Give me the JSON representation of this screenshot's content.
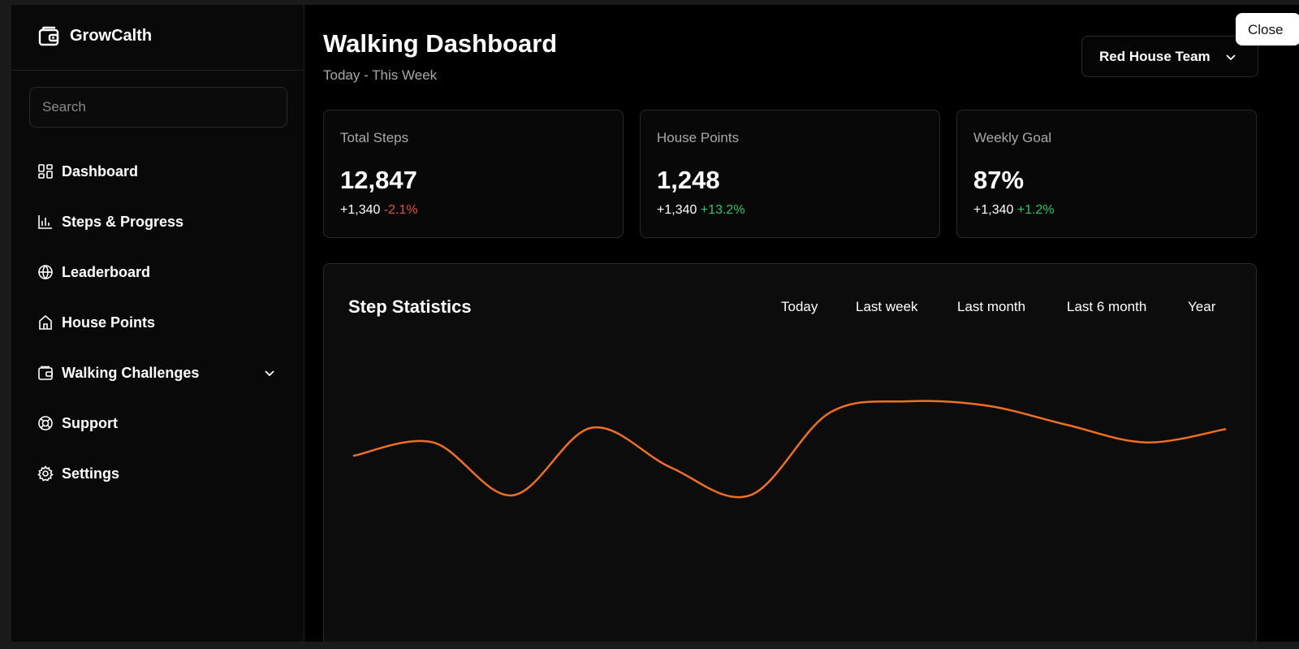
{
  "app": {
    "name": "GrowCalth"
  },
  "sidebar": {
    "search_placeholder": "Search",
    "items": [
      {
        "label": "Dashboard",
        "icon": "dashboard-icon"
      },
      {
        "label": "Steps & Progress",
        "icon": "bar-chart-icon"
      },
      {
        "label": "Leaderboard",
        "icon": "globe-icon"
      },
      {
        "label": "House Points",
        "icon": "home-icon"
      },
      {
        "label": "Walking Challenges",
        "icon": "wallet-icon"
      },
      {
        "label": "Support",
        "icon": "lifebuoy-icon"
      },
      {
        "label": "Settings",
        "icon": "gear-icon"
      }
    ]
  },
  "header": {
    "title": "Walking Dashboard",
    "subtitle": "Today - This Week",
    "team_select": "Red House Team",
    "close_label": "Close"
  },
  "cards": [
    {
      "label": "Total Steps",
      "value": "12,847",
      "delta": "+1,340",
      "change": "-2.1%",
      "trend": "negative"
    },
    {
      "label": "House Points",
      "value": "1,248",
      "delta": "+1,340",
      "change": "+13.2%",
      "trend": "positive"
    },
    {
      "label": "Weekly Goal",
      "value": "87%",
      "delta": "+1,340",
      "change": "+1.2%",
      "trend": "positive"
    }
  ],
  "stats": {
    "title": "Step Statistics",
    "tabs": [
      "Today",
      "Last week",
      "Last month",
      "Last 6 month",
      "Year"
    ]
  },
  "colors": {
    "accent": "#f07020",
    "negative": "#e0524a",
    "positive": "#31c46a"
  },
  "chart_data": {
    "type": "line",
    "series": [
      {
        "values": [
          0.63,
          0.72,
          0.36,
          0.82,
          0.55,
          0.36,
          0.92,
          1.0,
          0.97,
          0.84,
          0.72,
          0.81
        ]
      }
    ],
    "ylim": [
      0,
      1.05
    ],
    "grid": false
  }
}
